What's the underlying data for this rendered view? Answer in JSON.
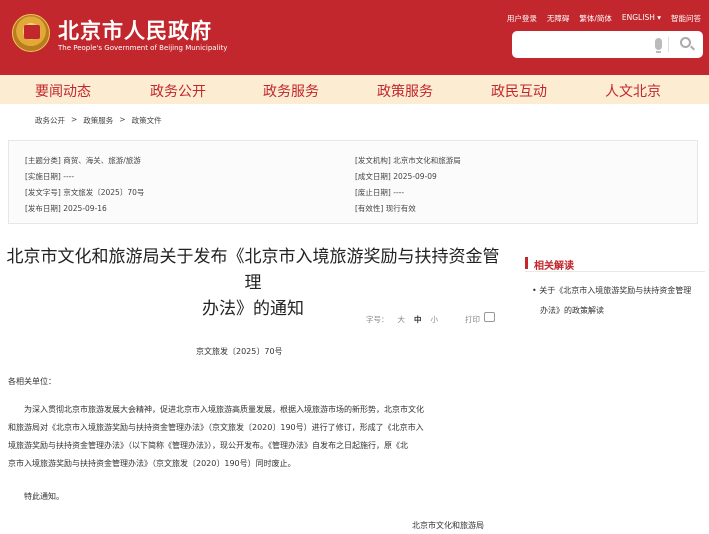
{
  "header": {
    "title": "北京市人民政府",
    "subtitle": "The People's Government of Beijing Municipality",
    "links": [
      "用户登录",
      "无障碍",
      "繁体/简体",
      "ENGLISH ▾",
      "智能问答"
    ],
    "search": {
      "placeholder": ""
    }
  },
  "nav": [
    "要闻动态",
    "政务公开",
    "政务服务",
    "政策服务",
    "政民互动",
    "人文北京"
  ],
  "breadcrumb": [
    "政务公开",
    ">",
    "政策服务",
    ">",
    "政策文件"
  ],
  "meta": {
    "subject": "[主题分类] 商贸、海关、旅游/旅游",
    "issuer": "[发文机构] 北京市文化和旅游局",
    "implement_date": "[实施日期] ----",
    "created_date": "[成文日期] 2025-09-09",
    "doc_number": "[发文字号] 京文旅发〔2025〕70号",
    "expire_date": "[废止日期] ----",
    "publish_date": "[发布日期] 2025-09-16",
    "validity": "[有效性] 现行有效"
  },
  "article": {
    "title_line1": "北京市文化和旅游局关于发布《北京市入境旅游奖励与扶持资金管理",
    "title_line2": "办法》的通知",
    "font_label": "字号：",
    "font_large": "大",
    "font_mid": "中",
    "font_small": "小",
    "print_label": "打印",
    "doc_no": "京文旅发〔2025〕70号",
    "salutation": "各相关单位：",
    "body_lines": [
      "为深入贯彻北京市旅游发展大会精神，促进北京市入境旅游高质量发展，根据入境旅游市场的新形势，北京市文化",
      "和旅游局对《北京市入境旅游奖励与扶持资金管理办法》（京文旅发〔2020〕190号）进行了修订，形成了《北京市入",
      "境旅游奖励与扶持资金管理办法》（以下简称《管理办法》），现公开发布。《管理办法》自发布之日起施行，原《北",
      "京市入境旅游奖励与扶持资金管理办法》（京文旅发〔2020〕190号）同时废止。"
    ],
    "closing": "特此通知。",
    "signature": "北京市文化和旅游局"
  },
  "sidebar": {
    "title": "相关解读",
    "item_line1": "• 关于《北京市入境旅游奖励与扶持资金管理",
    "item_line2": "办法》的政策解读"
  }
}
